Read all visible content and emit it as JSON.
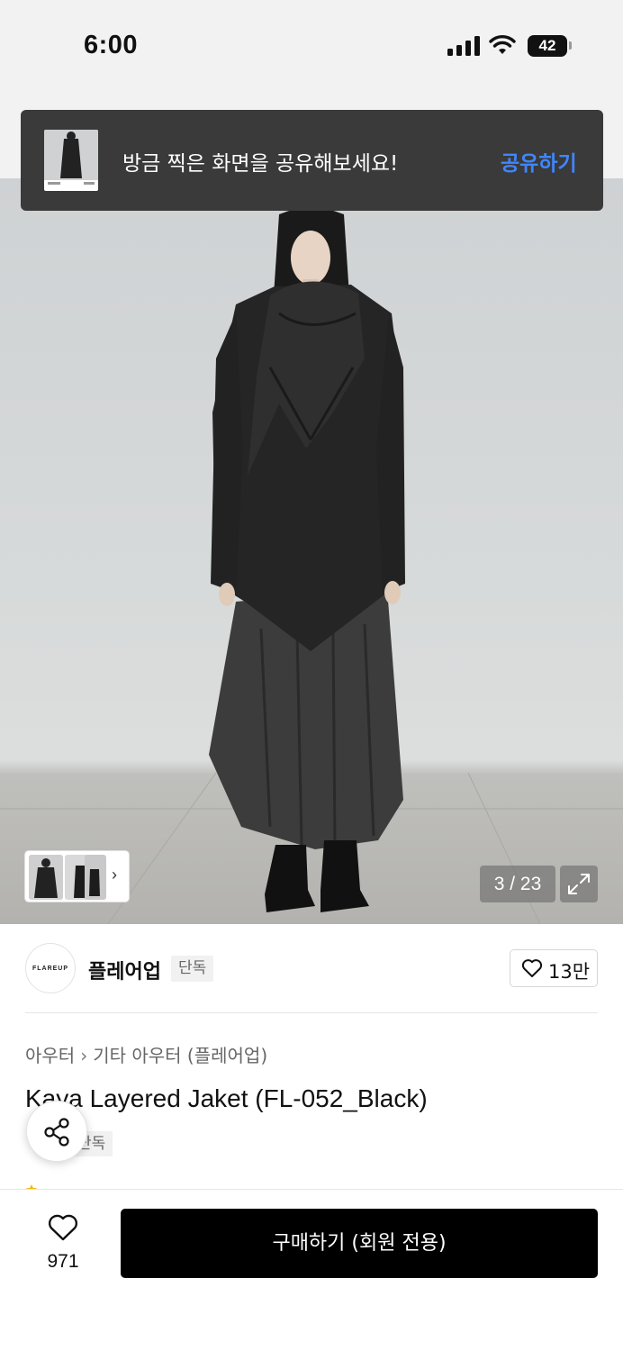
{
  "status_bar": {
    "time": "6:00",
    "battery": "42",
    "icons": [
      "cellular-signal-icon",
      "wifi-icon",
      "battery-icon"
    ]
  },
  "toast": {
    "message": "방금 찍은 화면을 공유해보세요!",
    "action_label": "공유하기",
    "action_color": "#3f86ff"
  },
  "gallery": {
    "counter": "3 / 23",
    "current_image": 3,
    "total_images": 23,
    "icons": [
      "chevron-right-icon",
      "expand-icon"
    ]
  },
  "brand": {
    "logo_text": "FLAREUP",
    "name": "플레어업",
    "badge": "단독",
    "like_count": "13만"
  },
  "product": {
    "breadcrumb": [
      "아우터",
      "기타 아우터 (플레어업)"
    ],
    "title": "Kaya Layered Jaket (FL-052_Black)",
    "badge": "단독"
  },
  "bottom_bar": {
    "like_count": "971",
    "buy_label": "구매하기 (회원 전용)"
  },
  "colors": {
    "accent_blue": "#3f86ff",
    "buy_button": "#000000",
    "toast_background": "#3a3a3a"
  }
}
